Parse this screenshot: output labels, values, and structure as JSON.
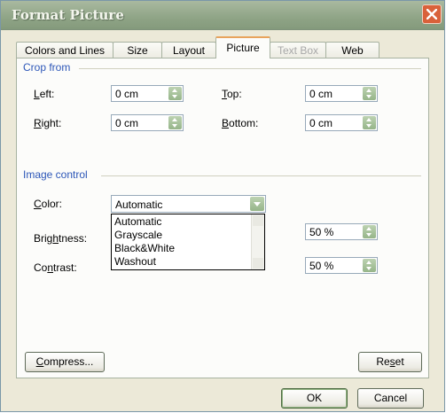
{
  "window": {
    "title": "Format Picture"
  },
  "tabs": [
    {
      "label": "Colors and Lines",
      "state": "normal"
    },
    {
      "label": "Size",
      "state": "normal"
    },
    {
      "label": "Layout",
      "state": "normal"
    },
    {
      "label": "Picture",
      "state": "active"
    },
    {
      "label": "Text Box",
      "state": "disabled"
    },
    {
      "label": "Web",
      "state": "normal"
    }
  ],
  "crop": {
    "heading": "Crop from",
    "left_label": "Left:",
    "left_value": "0 cm",
    "top_label": "Top:",
    "top_value": "0 cm",
    "right_label": "Right:",
    "right_value": "0 cm",
    "bottom_label": "Bottom:",
    "bottom_value": "0 cm"
  },
  "image_control": {
    "heading": "Image control",
    "color_label": "Color:",
    "color_value": "Automatic",
    "color_options": [
      "Automatic",
      "Grayscale",
      "Black&White",
      "Washout"
    ],
    "brightness_label": "Brightness:",
    "brightness_value": "50 %",
    "contrast_label": "Contrast:",
    "contrast_value": "50 %"
  },
  "buttons": {
    "compress": "Compress...",
    "reset": "Reset",
    "ok": "OK",
    "cancel": "Cancel"
  },
  "colors": {
    "title_bar": "#8fa486",
    "dialog_bg": "#ece9d8",
    "group_heading": "#2d57b8",
    "close_button": "#d9613a"
  }
}
